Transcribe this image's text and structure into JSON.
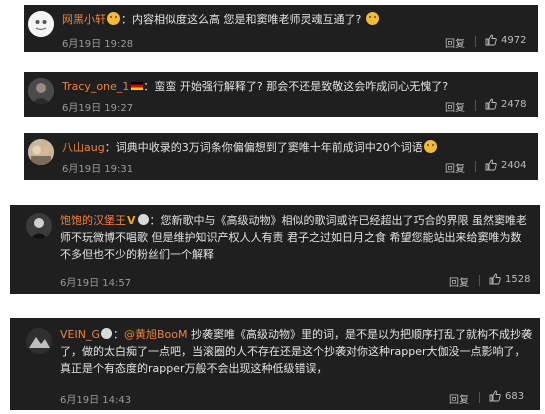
{
  "reply_label": "回复",
  "comments": [
    {
      "username": "网黑小轩",
      "text": "：内容相似度这么高 您是和窦唯老师灵魂互通了?",
      "date": "6月19日 19:28",
      "likes": "4972"
    },
    {
      "username": "Tracy_one_1",
      "text": "：蛮蛮 开始强行解释了? 那会不还是致敬这会咋成问心无愧了?",
      "date": "6月19日 19:27",
      "likes": "2478"
    },
    {
      "username": "八山aug",
      "text": "：词典中收录的3万词条你偏偏想到了窦唯十年前成词中20个词语",
      "date": "6月19日 19:31",
      "likes": "2404"
    },
    {
      "username": "饱饱的汉堡王",
      "text": "：您新歌中与《高级动物》相似的歌词或许已经超出了巧合的界限 虽然窦唯老师不玩微博不唱歌 但是维护知识产权人人有责 君子之过如日月之食 希望您能站出来给窦唯为数不多但也不少的粉丝们一个解释",
      "date": "6月19日 14:57",
      "likes": "1528"
    },
    {
      "username": "VEIN_G",
      "mention": "@黄旭BooM",
      "text": " 抄袭窦唯《高级动物》里的词，是不是以为把顺序打乱了就构不成抄袭了，做的太白痴了一点吧，当滚圈的人不存在还是这个抄袭对你这种rapper大伽没一点影响了，真正是个有态度的rapper万般不会出现这种低级错误，",
      "date": "6月19日 14:43",
      "likes": "683"
    }
  ]
}
